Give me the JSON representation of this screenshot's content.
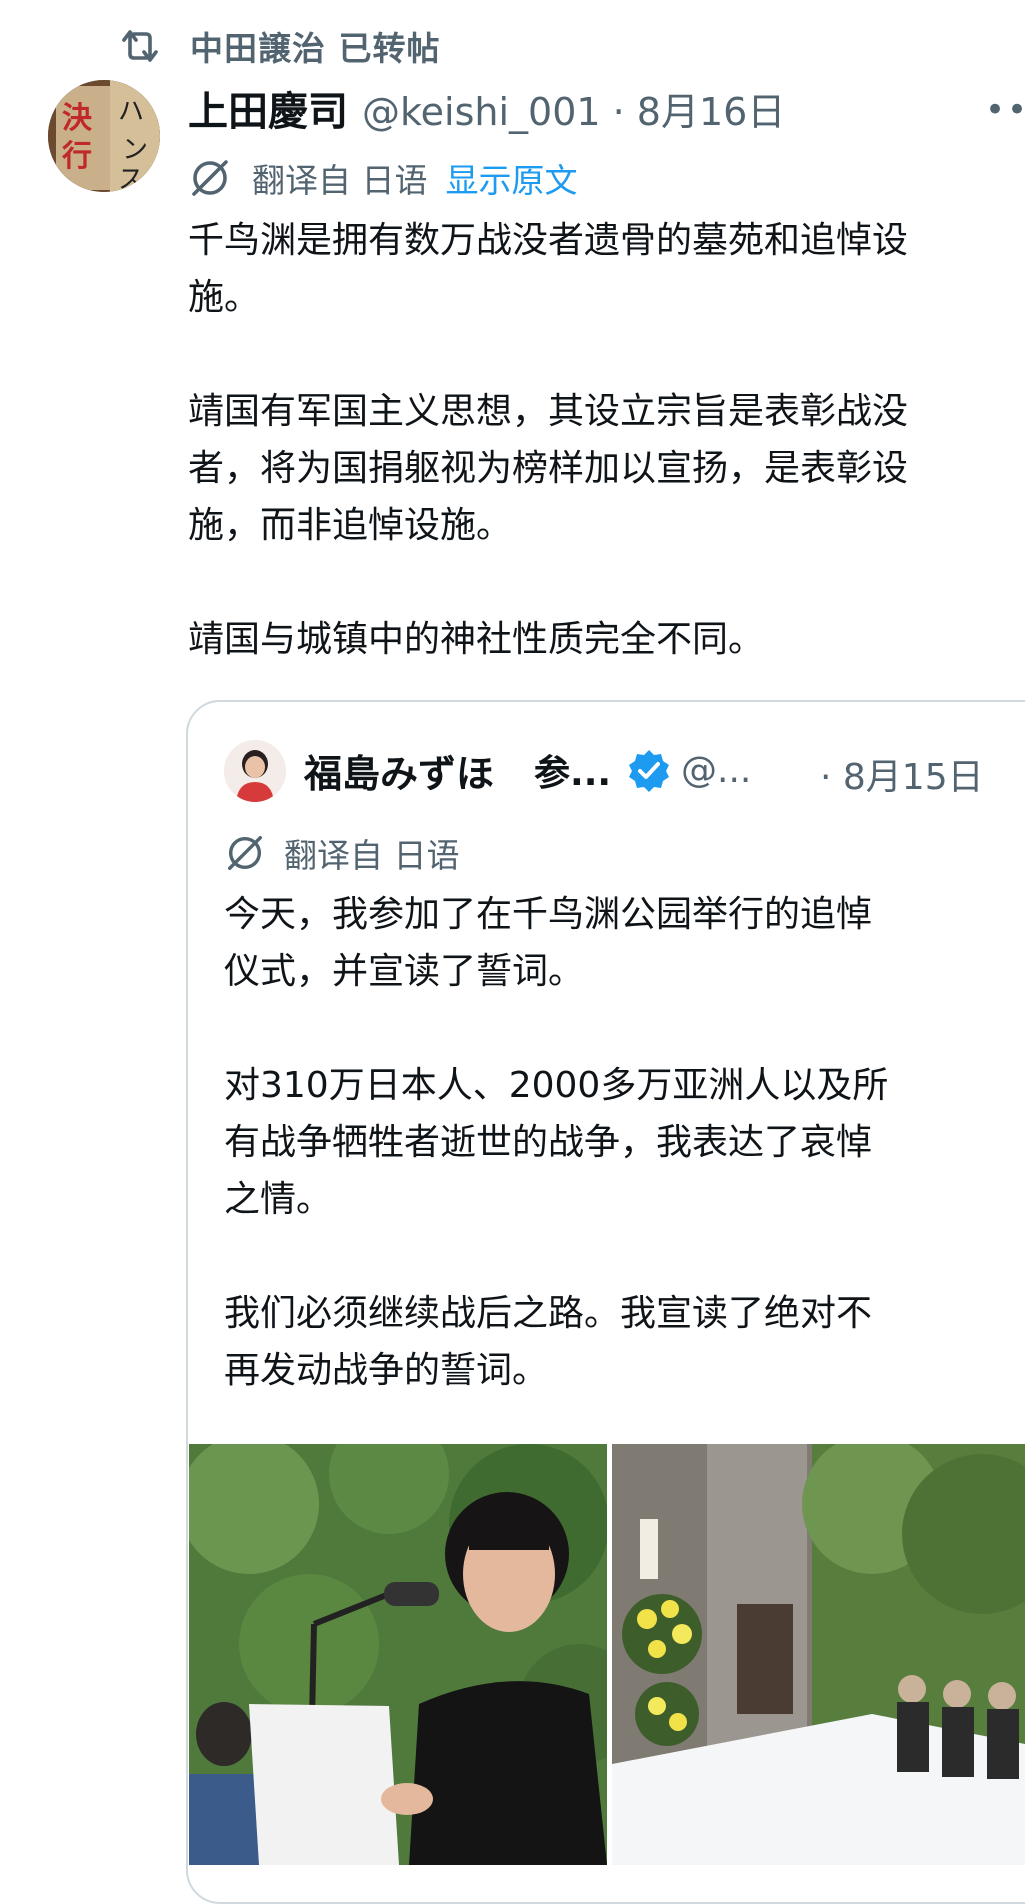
{
  "retweet": {
    "icon": "retweet-icon",
    "text": "中田譲治 已转帖"
  },
  "author": {
    "name": "上田慶司",
    "meta": "@keishi_001 · 8月16日",
    "avatar_text": "決行"
  },
  "translation": {
    "label": "翻译自 日语",
    "show_original": "显示原文"
  },
  "more_label": "•••",
  "tweet_text": [
    "千鸟渊是拥有数万战没者遗骨的墓苑和追悼设",
    "施。",
    "",
    "靖国有军国主义思想，其设立宗旨是表彰战没",
    "者，将为国捐躯视为榜样加以宣扬，是表彰设",
    "施，而非追悼设施。",
    "",
    "靖国与城镇中的神社性质完全不同。"
  ],
  "quote": {
    "name": "福島みずほ",
    "name2": "参...",
    "verified": true,
    "handle": "@...",
    "date": "· 8月15日",
    "translation_label": "翻译自 日语",
    "text": [
      "今天，我参加了在千鸟渊公园举行的追悼",
      "仪式，并宣读了誓词。",
      "",
      "对310万日本人、2000多万亚洲人以及所",
      "有战争牺牲者逝世的战争，我表达了哀悼",
      "之情。",
      "",
      "我们必须继续战后之路。我宣读了绝对不",
      "再发动战争的誓词。"
    ]
  },
  "colors": {
    "text": "#0f1419",
    "secondary": "#536471",
    "link": "#1d9bf0",
    "border": "#cfd9de",
    "verified": "#1d9bf0"
  }
}
